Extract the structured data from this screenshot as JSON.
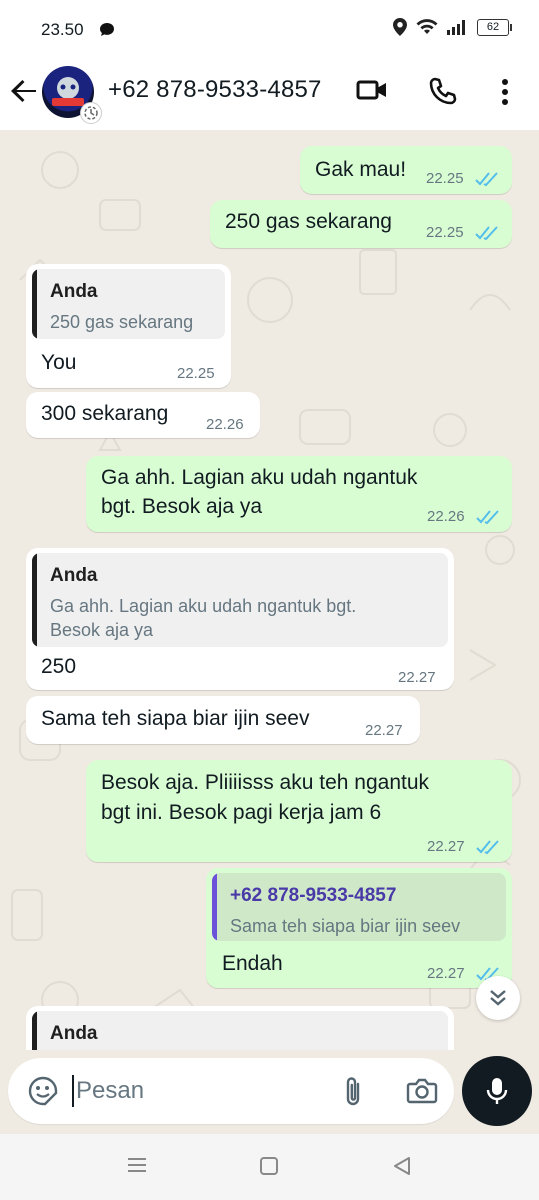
{
  "status_bar": {
    "time": "23.50",
    "battery": "62"
  },
  "header": {
    "contact_name": "+62 878-9533-4857"
  },
  "messages": [
    {
      "dir": "out",
      "text": "Gak mau!",
      "time": "22.25"
    },
    {
      "dir": "out",
      "text": "250 gas sekarang",
      "time": "22.25"
    },
    {
      "dir": "in",
      "quote_name": "Anda",
      "quote_text": "250 gas sekarang",
      "text": "You",
      "time": "22.25"
    },
    {
      "dir": "in",
      "text": "300 sekarang",
      "time": "22.26"
    },
    {
      "dir": "out",
      "text_lines": [
        "Ga ahh. Lagian aku udah ngantuk",
        "bgt. Besok aja ya"
      ],
      "time": "22.26"
    },
    {
      "dir": "in",
      "quote_name": "Anda",
      "quote_text_lines": [
        "Ga ahh. Lagian aku udah ngantuk bgt.",
        "Besok aja ya"
      ],
      "text": "250",
      "time": "22.27"
    },
    {
      "dir": "in",
      "text": "Sama teh siapa biar ijin seev",
      "time": "22.27"
    },
    {
      "dir": "out",
      "text_lines": [
        "Besok aja. Pliiiisss aku teh ngantuk",
        "bgt ini. Besok pagi kerja jam 6"
      ],
      "time": "22.27"
    },
    {
      "dir": "out",
      "quote_name": "+62 878-9533-4857",
      "quote_text": "Sama teh siapa biar ijin seev",
      "text": "Endah",
      "time": "22.27"
    },
    {
      "dir": "in",
      "quote_name": "Anda"
    }
  ],
  "composer": {
    "placeholder": "Pesan"
  },
  "icons": {
    "back": "arrow-left-icon",
    "video": "video-call-icon",
    "phone": "phone-icon",
    "menu": "more-vert-icon",
    "emoji": "sticker-icon",
    "attach": "paperclip-icon",
    "camera": "camera-icon",
    "mic": "mic-icon",
    "scroll": "double-chevron-down-icon",
    "read": "double-check-icon"
  },
  "colors": {
    "outgoing": "#d9fdd3",
    "incoming": "#ffffff",
    "read_tick": "#53bdeb",
    "quote_name_in": "#1f1f1f",
    "quote_name_out": "#4a3aa8",
    "quote_bar_out": "#6b52d8"
  }
}
